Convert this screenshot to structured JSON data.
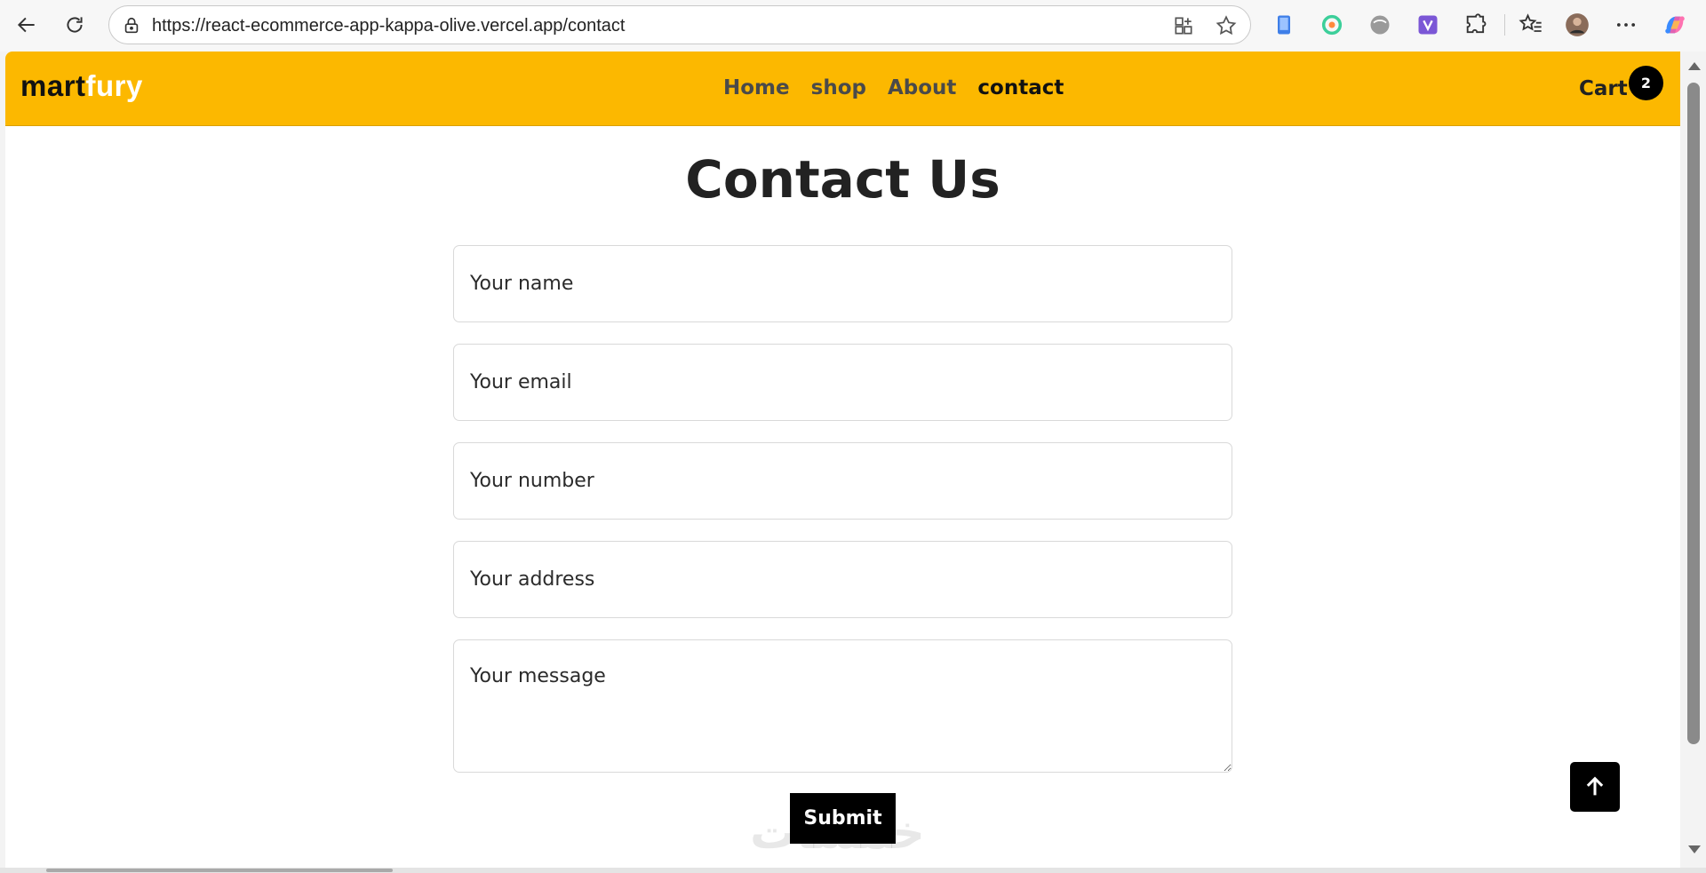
{
  "browser": {
    "url": "https://react-ecommerce-app-kappa-olive.vercel.app/contact",
    "icons": [
      "back-icon",
      "refresh-icon",
      "lock-icon",
      "app-grid-icon",
      "star-icon",
      "extension-icons",
      "puzzle-icon",
      "favorites-icon",
      "avatar",
      "more-icon",
      "copilot-icon"
    ]
  },
  "header": {
    "logo_part1": "mart",
    "logo_part2": "fury",
    "nav": [
      {
        "label": "Home"
      },
      {
        "label": "shop"
      },
      {
        "label": "About"
      },
      {
        "label": "contact",
        "active": true
      }
    ],
    "cart_label": "Cart",
    "cart_count": "2",
    "brand_color": "#fcb800"
  },
  "main": {
    "title": "Contact Us",
    "fields": {
      "name_placeholder": "Your name",
      "email_placeholder": "Your email",
      "number_placeholder": "Your number",
      "address_placeholder": "Your address",
      "message_placeholder": "Your message"
    },
    "submit_label": "Submit",
    "watermark": "خمسات"
  }
}
